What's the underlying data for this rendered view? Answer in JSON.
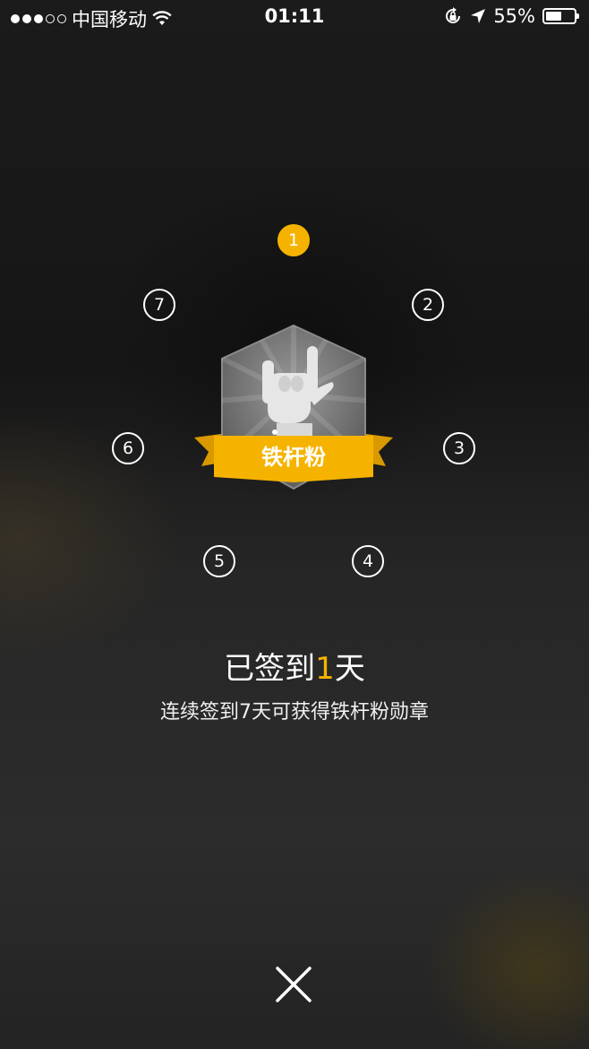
{
  "status_bar": {
    "carrier": "中国移动",
    "time": "01:11",
    "battery_percent_label": "55%",
    "battery_level": 0.55,
    "signal_bars": 3,
    "signal_total": 5,
    "icons": [
      "wifi-icon",
      "rotation-lock-icon",
      "location-arrow-icon",
      "battery-icon"
    ]
  },
  "checkin": {
    "days": [
      "1",
      "2",
      "3",
      "4",
      "5",
      "6",
      "7"
    ],
    "active_day": "1",
    "badge_name": "铁杆粉",
    "badge_icon": "rock-hand-icon",
    "status_prefix": "已签到",
    "status_count": "1",
    "status_suffix": "天",
    "description": "连续签到7天可获得铁杆粉勋章"
  },
  "colors": {
    "accent": "#f5b300",
    "badge_hex": "#6a6a6a",
    "ribbon_dark": "#d89a00"
  },
  "close_icon": "close-icon"
}
